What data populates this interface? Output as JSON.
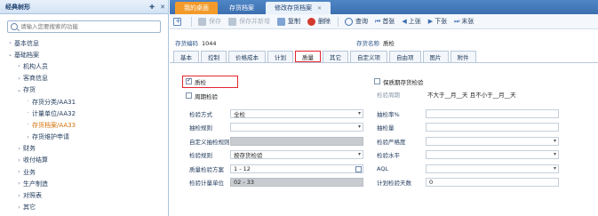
{
  "left_panel": {
    "title": "经典树形",
    "pin": "✚",
    "close": "✕",
    "search_placeholder": "请输入您要搜索的功能",
    "tree": [
      {
        "label": "基本信息",
        "level": 0,
        "arrow": "›"
      },
      {
        "label": "基础档案",
        "level": 0,
        "arrow": "⌄"
      },
      {
        "label": "机构人员",
        "level": 1,
        "arrow": "›"
      },
      {
        "label": "客商信息",
        "level": 1,
        "arrow": "›"
      },
      {
        "label": "存货",
        "level": 1,
        "arrow": "⌄"
      },
      {
        "label": "存货分类/AA31",
        "level": 2,
        "arrow": "·"
      },
      {
        "label": "计量单位/AA32",
        "level": 2,
        "arrow": "·"
      },
      {
        "label": "存货档案/AA33",
        "level": 2,
        "arrow": "·",
        "selected": true
      },
      {
        "label": "存货维护申请",
        "level": 2,
        "arrow": "›"
      },
      {
        "label": "财务",
        "level": 1,
        "arrow": "›"
      },
      {
        "label": "收付结算",
        "level": 1,
        "arrow": "›"
      },
      {
        "label": "业务",
        "level": 1,
        "arrow": "›"
      },
      {
        "label": "生产制造",
        "level": 1,
        "arrow": "›"
      },
      {
        "label": "对照表",
        "level": 1,
        "arrow": "›"
      },
      {
        "label": "其它",
        "level": 1,
        "arrow": "›"
      }
    ]
  },
  "tabs": [
    {
      "label": "我的桌面",
      "style": "orange"
    },
    {
      "label": "存货档案",
      "style": "plain"
    },
    {
      "label": "修改存货档案",
      "style": "active",
      "close": "✕"
    }
  ],
  "toolbar": {
    "add": "",
    "save": "保存",
    "save_add": "保存并新增",
    "copy": "复制",
    "delete": "删除",
    "query": "查询",
    "first": "首张",
    "prev": "上张",
    "next": "下张",
    "last": "末张"
  },
  "header": {
    "code_label": "存货编码",
    "code_value": "1044",
    "name_label": "存货名称",
    "name_value": "质检"
  },
  "subtabs": [
    "基本",
    "控制",
    "价格成本",
    "计划",
    "质量",
    "其它",
    "自定义项",
    "自由项",
    "图片",
    "附件"
  ],
  "form": {
    "qc_check": "质检",
    "periodic_check": "周期检验",
    "keep_check": "保质期存货检验",
    "check_period_label": "检验周期",
    "expiry_text": "不大于__月__天 且不小于__月__天",
    "rows_left": [
      {
        "label": "检验方式",
        "value": "全检",
        "type": "select"
      },
      {
        "label": "抽检规则",
        "value": "",
        "type": "select"
      },
      {
        "label": "自定义抽检规则",
        "value": "",
        "type": "gray"
      },
      {
        "label": "检验规则",
        "value": "按存货检验",
        "type": "select"
      },
      {
        "label": "质量检验方案",
        "value": "1 - 12",
        "type": "date"
      },
      {
        "label": "检验计量单位",
        "value": "02 - 33",
        "type": "gray"
      }
    ],
    "rows_right": [
      {
        "label": "抽检率%",
        "value": ""
      },
      {
        "label": "抽检量",
        "value": ""
      },
      {
        "label": "检验严格度",
        "value": "",
        "type": "select"
      },
      {
        "label": "检验水平",
        "value": "",
        "type": "select"
      },
      {
        "label": "AQL",
        "value": "",
        "type": "select"
      },
      {
        "label": "计划检验天数",
        "value": "0"
      }
    ]
  }
}
